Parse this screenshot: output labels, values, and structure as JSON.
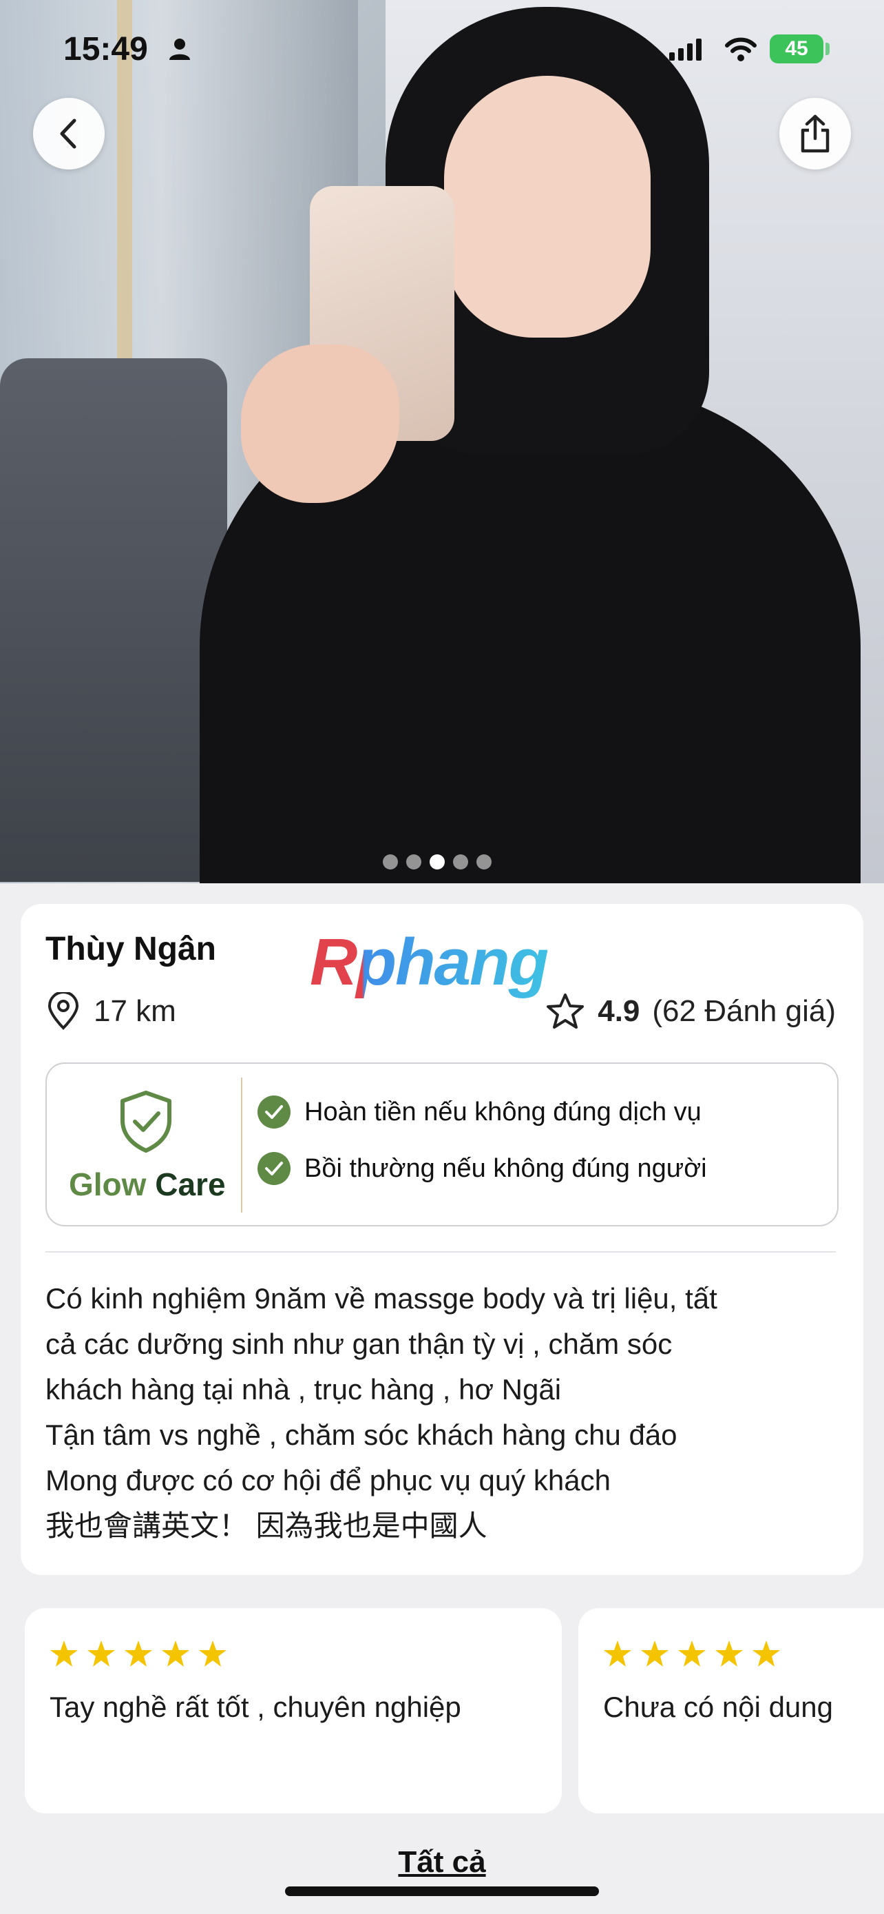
{
  "status_bar": {
    "time": "15:49",
    "battery": "45"
  },
  "gallery": {
    "image_count": 5,
    "active_index": 2
  },
  "profile": {
    "name": "Thùy Ngân",
    "distance": "17 km",
    "rating": "4.9",
    "review_count": "(62 Đánh giá)",
    "watermark": "Rphang"
  },
  "glow_care": {
    "brand_part1": "Glow",
    "brand_part2": "Care",
    "items": [
      "Hoàn tiền nếu không đúng dịch vụ",
      "Bồi thường nếu không đúng người"
    ]
  },
  "description": [
    "Có kinh nghiệm 9năm về massge body và trị liệu, tất",
    "cả các dưỡng sinh như gan thận tỳ vị , chăm sóc",
    "khách hàng tại nhà , trục hàng , hơ Ngãi",
    "Tận tâm vs nghề , chăm sóc khách hàng chu đáo",
    "Mong được có cơ hội để phục vụ quý khách",
    "我也會講英文！ 因為我也是中國人"
  ],
  "reviews": [
    {
      "stars": 5,
      "text": "Tay nghề rất tốt , chuyên nghiệp"
    },
    {
      "stars": 5,
      "text": "Chưa có nội dung"
    }
  ],
  "see_all_label": "Tất cả",
  "colors": {
    "accent_green": "#5e8a45",
    "star": "#f5c400",
    "battery": "#3cc35a"
  }
}
